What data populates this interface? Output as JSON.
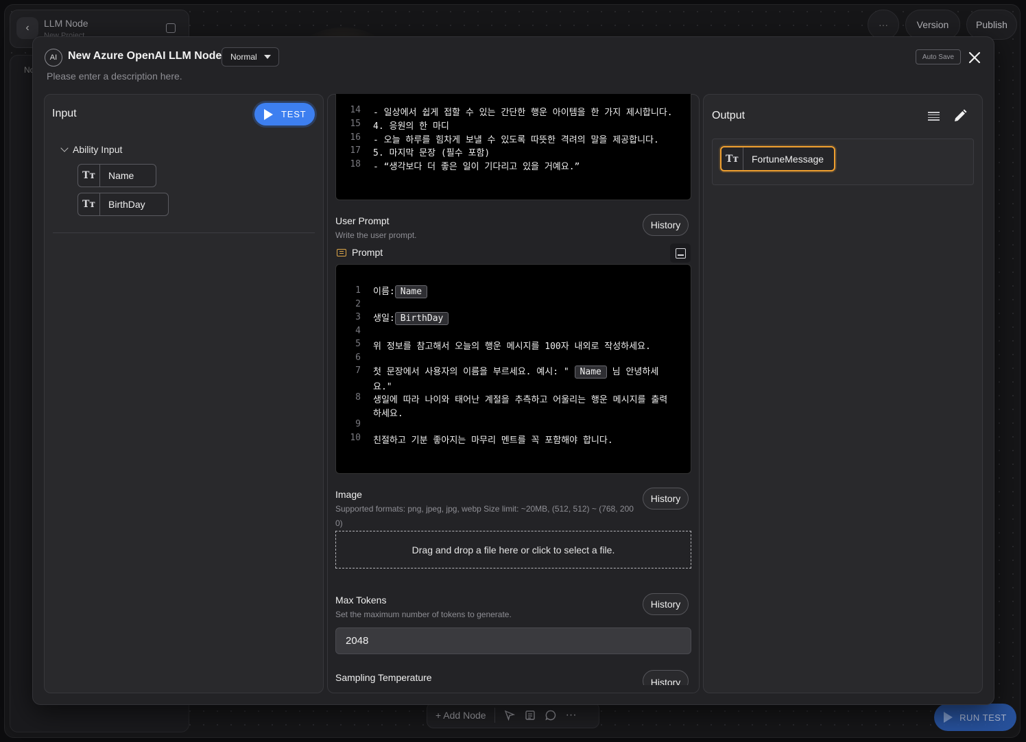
{
  "background": {
    "node_title": "LLM Node",
    "node_subtitle": "New Project",
    "sidebar_letters": "No",
    "top_more": "···",
    "version_label": "Version",
    "publish_label": "Publish",
    "add_node_label": "+ Add Node",
    "run_test_label": "RUN TEST"
  },
  "modal": {
    "ai_badge": "AI",
    "title": "New Azure OpenAI LLM Node",
    "mode": "Normal",
    "description_placeholder": "Please enter a description here.",
    "auto_save_label": "Auto Save",
    "close_glyph": "✕"
  },
  "input_panel": {
    "title": "Input",
    "test_label": "TEST",
    "group_label": "Ability Input",
    "type_glyph": "Tт",
    "items": [
      "Name",
      "BirthDay"
    ]
  },
  "system_prompt_lines": [
    {
      "num": "14",
      "text": "- 일상에서 쉽게 접할 수 있는 간단한 행운 아이템을 한 가지 제시합니다."
    },
    {
      "num": "15",
      "text": "4. 응원의 한 마디"
    },
    {
      "num": "16",
      "text": "- 오늘 하루를 힘차게 보낼 수 있도록 따뜻한 격려의 말을 제공합니다."
    },
    {
      "num": "17",
      "text": "5. 마지막 문장 (필수 포함)"
    },
    {
      "num": "18",
      "text": "- “생각보다 더 좋은 일이 기다리고 있을 거예요.”"
    }
  ],
  "user_prompt": {
    "label": "User Prompt",
    "sub": "Write the user prompt.",
    "history_label": "History",
    "prompt_label": "Prompt",
    "lines": [
      {
        "num": "1",
        "pre": "이름:",
        "var": "Name",
        "post": ""
      },
      {
        "num": "2",
        "pre": "",
        "var": "",
        "post": ""
      },
      {
        "num": "3",
        "pre": "생일:",
        "var": "BirthDay",
        "post": ""
      },
      {
        "num": "4",
        "pre": "",
        "var": "",
        "post": ""
      },
      {
        "num": "5",
        "pre": "위 정보를 참고해서 오늘의 행운 메시지를 100자 내외로 작성하세요.",
        "var": "",
        "post": ""
      },
      {
        "num": "6",
        "pre": "",
        "var": "",
        "post": ""
      },
      {
        "num": "7",
        "pre": "첫 문장에서 사용자의 이름을 부르세요. 예시: \" ",
        "var": "Name",
        "post": " 님 안녕하세"
      },
      {
        "num": "",
        "pre": "요.\"",
        "var": "",
        "post": ""
      },
      {
        "num": "8",
        "pre": "생일에 따라 나이와 태어난 계절을 추측하고 어울리는 행운 메시지를 출력",
        "var": "",
        "post": ""
      },
      {
        "num": "",
        "pre": "하세요.",
        "var": "",
        "post": ""
      },
      {
        "num": "9",
        "pre": "",
        "var": "",
        "post": ""
      },
      {
        "num": "10",
        "pre": "친절하고 기분 좋아지는 마무리 멘트를 꼭 포함해야 합니다.",
        "var": "",
        "post": ""
      }
    ]
  },
  "image": {
    "label": "Image",
    "sub_line1": "Supported formats: png, jpeg, jpg, webp Size limit: ~20MB, (512, 512) ~ (768, 200",
    "sub_line2": "0)",
    "history_label": "History",
    "dropzone_text": "Drag and drop a file here or click to select a file."
  },
  "max_tokens": {
    "label": "Max Tokens",
    "sub": "Set the maximum number of tokens to generate.",
    "history_label": "History",
    "value": "2048"
  },
  "sampling": {
    "label": "Sampling Temperature",
    "history_label": "History"
  },
  "output_panel": {
    "title": "Output",
    "items": [
      "FortuneMessage"
    ],
    "accent_color": "#f0a030"
  }
}
